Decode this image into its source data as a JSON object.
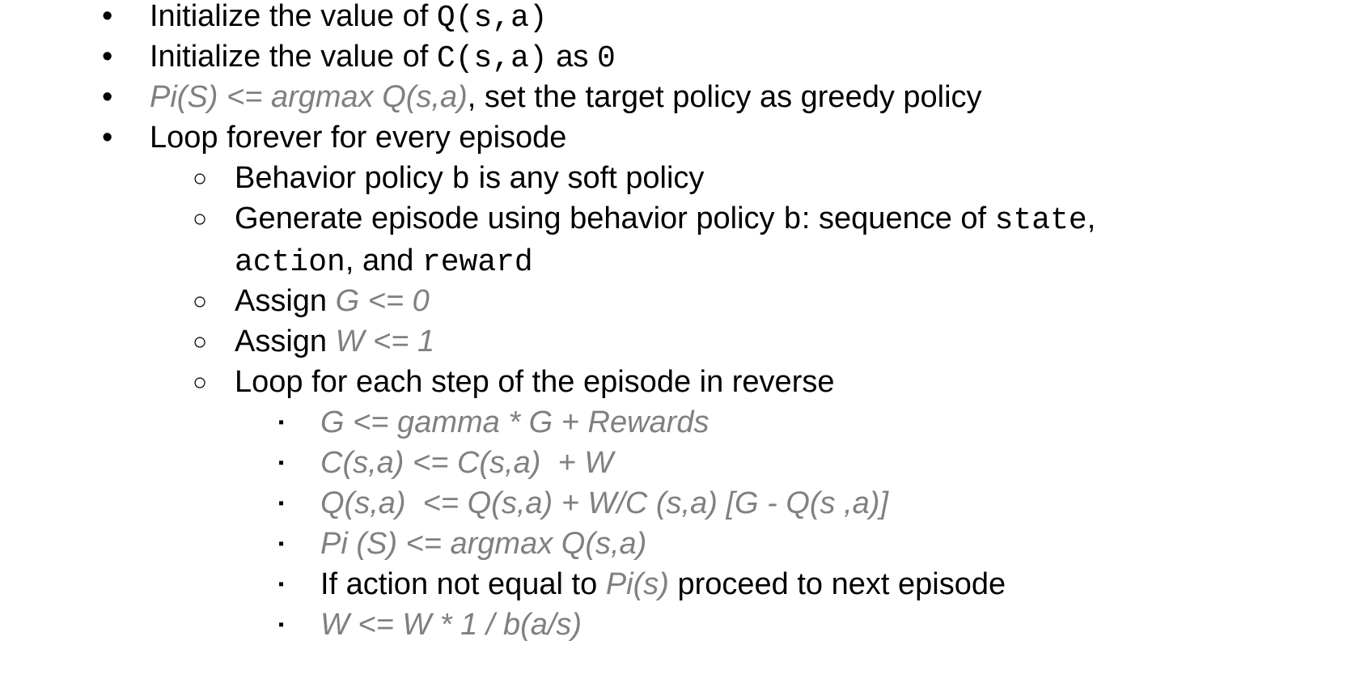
{
  "bullets": {
    "disc": "•",
    "circle": "○",
    "square": "▪"
  },
  "items": [
    {
      "level": 1,
      "segments": [
        {
          "text": "Initialize the value of ",
          "style": "normal"
        },
        {
          "text": "Q(s,a)",
          "style": "code"
        }
      ]
    },
    {
      "level": 1,
      "segments": [
        {
          "text": "Initialize the value of ",
          "style": "normal"
        },
        {
          "text": "C(s,a)",
          "style": "code"
        },
        {
          "text": " as ",
          "style": "normal"
        },
        {
          "text": "0",
          "style": "code"
        }
      ]
    },
    {
      "level": 1,
      "segments": [
        {
          "text": "Pi(S) <= argmax Q(s,a)",
          "style": "math"
        },
        {
          "text": ", set the target policy as greedy policy",
          "style": "normal"
        }
      ]
    },
    {
      "level": 1,
      "segments": [
        {
          "text": "Loop forever for every episode",
          "style": "normal"
        }
      ]
    },
    {
      "level": 2,
      "segments": [
        {
          "text": "Behavior policy ",
          "style": "normal"
        },
        {
          "text": "b",
          "style": "code"
        },
        {
          "text": " is any soft policy",
          "style": "normal"
        }
      ]
    },
    {
      "level": 2,
      "segments": [
        {
          "text": "Generate episode using behavior policy ",
          "style": "normal"
        },
        {
          "text": "b",
          "style": "code"
        },
        {
          "text": ": sequence of ",
          "style": "normal"
        },
        {
          "text": "state",
          "style": "code"
        },
        {
          "text": ",",
          "style": "normal"
        }
      ]
    },
    {
      "level": 2,
      "continuation": true,
      "segments": [
        {
          "text": "action",
          "style": "code"
        },
        {
          "text": ", and ",
          "style": "normal"
        },
        {
          "text": "reward",
          "style": "code"
        }
      ]
    },
    {
      "level": 2,
      "segments": [
        {
          "text": "Assign ",
          "style": "normal"
        },
        {
          "text": "G <= 0",
          "style": "math"
        }
      ]
    },
    {
      "level": 2,
      "segments": [
        {
          "text": "Assign ",
          "style": "normal"
        },
        {
          "text": "W <= 1",
          "style": "math"
        }
      ]
    },
    {
      "level": 2,
      "segments": [
        {
          "text": "Loop for each step of the episode in reverse",
          "style": "normal"
        }
      ]
    },
    {
      "level": 3,
      "segments": [
        {
          "text": "G <= gamma * G + Rewards",
          "style": "math"
        }
      ]
    },
    {
      "level": 3,
      "segments": [
        {
          "text": "C(s,a) <= C(s,a)  + W",
          "style": "math"
        }
      ]
    },
    {
      "level": 3,
      "segments": [
        {
          "text": "Q(s,a)  <= Q(s,a) + W/C (s,a) [G - Q(s ,a)]",
          "style": "math"
        }
      ]
    },
    {
      "level": 3,
      "segments": [
        {
          "text": "Pi (S) <= argmax Q(s,a)",
          "style": "math"
        }
      ]
    },
    {
      "level": 3,
      "segments": [
        {
          "text": "If action not equal to ",
          "style": "normal"
        },
        {
          "text": "Pi(s)",
          "style": "math"
        },
        {
          "text": " proceed to next episode",
          "style": "normal"
        }
      ]
    },
    {
      "level": 3,
      "segments": [
        {
          "text": "W <= W * 1 / b(a/s)",
          "style": "math"
        }
      ]
    }
  ]
}
